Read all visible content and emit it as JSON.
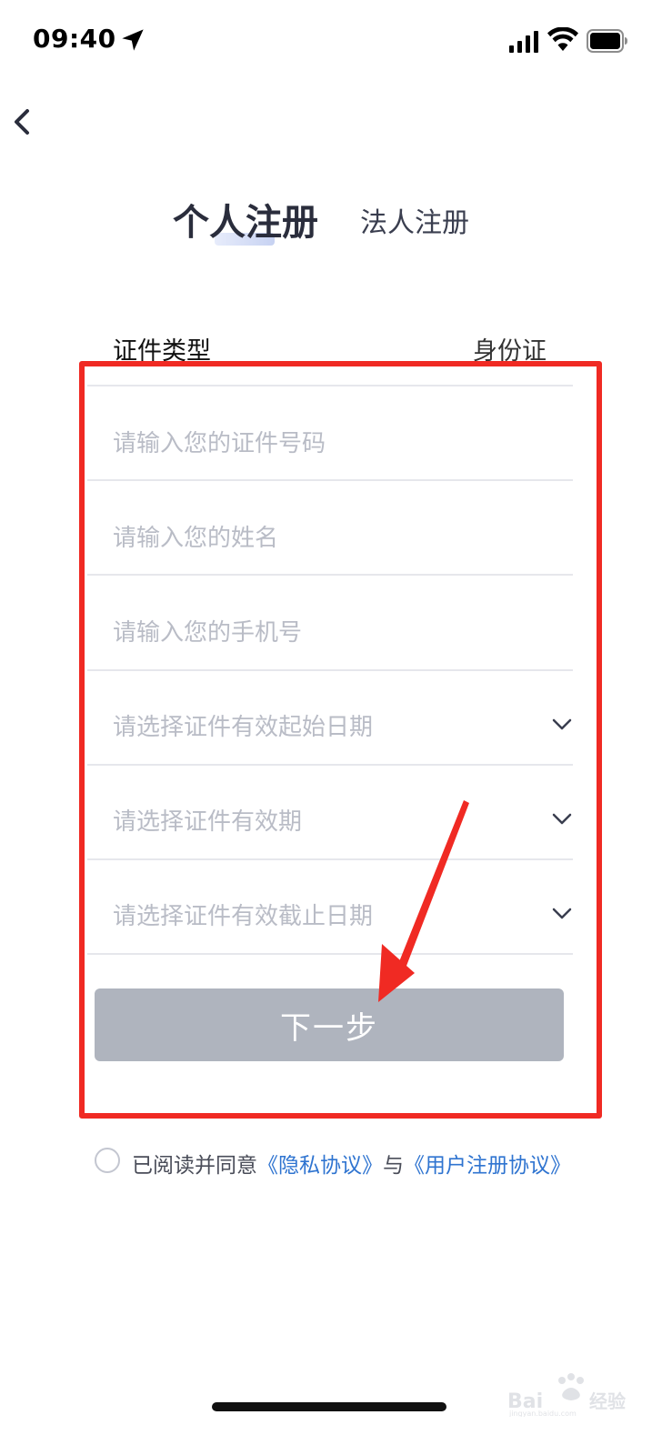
{
  "status_bar": {
    "time": "09:40"
  },
  "tabs": [
    {
      "label": "个人注册",
      "active": true
    },
    {
      "label": "法人注册",
      "active": false
    }
  ],
  "id_type": {
    "label": "证件类型",
    "value": "身份证"
  },
  "fields": [
    {
      "placeholder": "请输入您的证件号码",
      "type": "input"
    },
    {
      "placeholder": "请输入您的姓名",
      "type": "input"
    },
    {
      "placeholder": "请输入您的手机号",
      "type": "input"
    },
    {
      "placeholder": "请选择证件有效起始日期",
      "type": "select"
    },
    {
      "placeholder": "请选择证件有效期",
      "type": "select"
    },
    {
      "placeholder": "请选择证件有效截止日期",
      "type": "select"
    }
  ],
  "next_button": {
    "label": "下一步"
  },
  "agreement": {
    "prefix": "已阅读并同意",
    "privacy_link": "《隐私协议》",
    "connector": "与",
    "user_link": "《用户注册协议》"
  },
  "colors": {
    "highlight": "#f02a23",
    "link": "#2f74d0",
    "button": "#afb4be"
  }
}
